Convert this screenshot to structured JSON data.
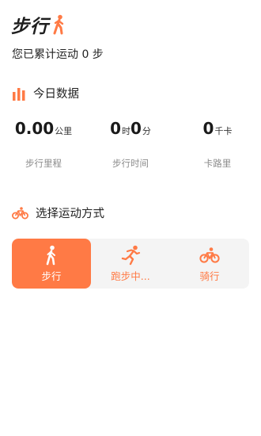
{
  "header": {
    "title": "步行",
    "icon": "walking-icon"
  },
  "summary": "您已累计运动 0 步",
  "today": {
    "title": "今日数据",
    "icon": "bar-chart-icon",
    "stats": [
      {
        "parts": [
          {
            "num": "0.00",
            "unit": "公里"
          }
        ],
        "label": "步行里程"
      },
      {
        "parts": [
          {
            "num": "0",
            "unit": "时"
          },
          {
            "num": "0",
            "unit": "分"
          }
        ],
        "label": "步行时间"
      },
      {
        "parts": [
          {
            "num": "0",
            "unit": "千卡"
          }
        ],
        "label": "卡路里"
      }
    ]
  },
  "modes_section": {
    "title": "选择运动方式",
    "icon": "bicycle-icon"
  },
  "modes": [
    {
      "label": "步行",
      "icon": "walking-icon",
      "active": true
    },
    {
      "label": "跑步中...",
      "icon": "running-icon",
      "active": false
    },
    {
      "label": "骑行",
      "icon": "bicycle-icon",
      "active": false
    }
  ],
  "colors": {
    "accent": "#ff7a45",
    "muted": "#8b8b8b",
    "card_bg": "#f4f4f4"
  }
}
